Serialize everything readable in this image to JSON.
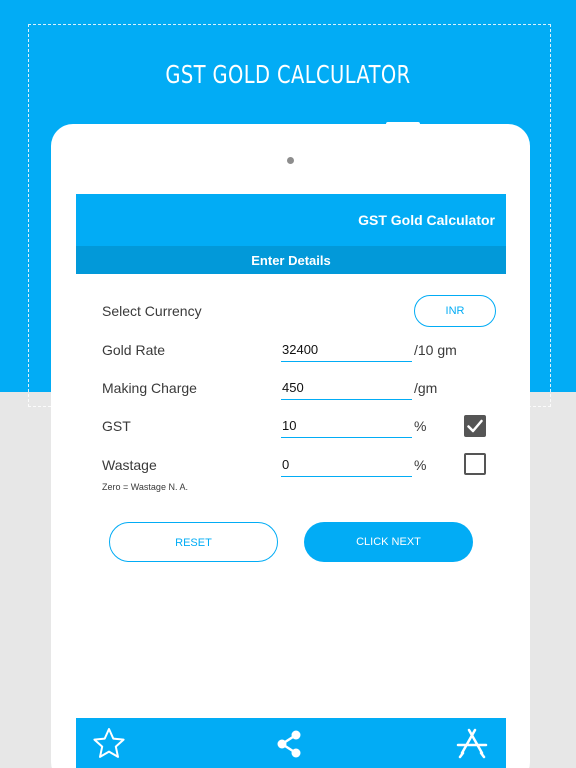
{
  "promo": {
    "title": "GST GOLD CALCULATOR"
  },
  "app_bar": {
    "title": "GST Gold Calculator"
  },
  "section": {
    "title": "Enter Details"
  },
  "form": {
    "currency_label": "Select Currency",
    "currency_value": "INR",
    "gold_rate_label": "Gold Rate",
    "gold_rate_value": "32400",
    "gold_rate_unit": "/10 gm",
    "making_charge_label": "Making Charge",
    "making_charge_value": "450",
    "making_charge_unit": "/gm",
    "gst_label": "GST",
    "gst_value": "10",
    "gst_unit": "%",
    "gst_checked": true,
    "wastage_label": "Wastage",
    "wastage_value": "0",
    "wastage_unit": "%",
    "wastage_checked": false,
    "wastage_hint": "Zero = Wastage N. A."
  },
  "buttons": {
    "reset": "RESET",
    "next": "CLICK NEXT"
  },
  "bottom_bar": {
    "icons": [
      "star-icon",
      "share-icon",
      "app-store-icon"
    ]
  },
  "colors": {
    "accent": "#02acf5",
    "section": "#0299d9",
    "checkbox": "#555555"
  }
}
